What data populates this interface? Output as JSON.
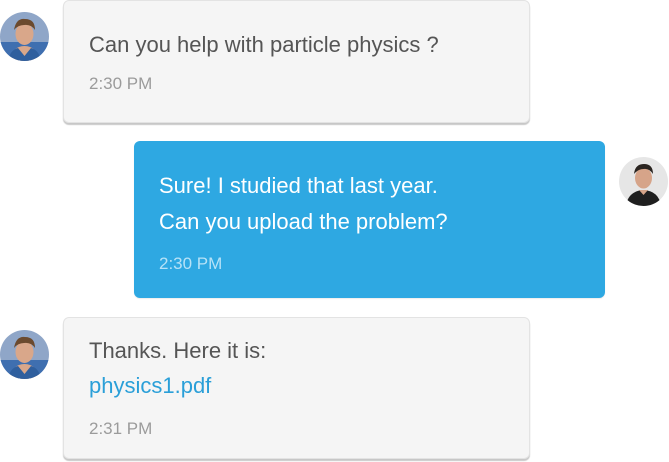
{
  "messages": [
    {
      "sender": "other",
      "avatar_icon": "user-avatar-icon",
      "text": "Can you help with particle physics ?",
      "time": "2:30 PM"
    },
    {
      "sender": "self",
      "avatar_icon": "user-avatar-icon",
      "lines": [
        "Sure! I studied that last year.",
        "Can you upload the problem?"
      ],
      "time": "2:30 PM"
    },
    {
      "sender": "other",
      "avatar_icon": "user-avatar-icon",
      "text": "Thanks. Here it is:",
      "attachment": "physics1.pdf",
      "time": "2:31 PM"
    }
  ],
  "colors": {
    "incoming_bubble": "#f5f5f5",
    "outgoing_bubble": "#2ea8e2",
    "link": "#2a9fd8"
  }
}
